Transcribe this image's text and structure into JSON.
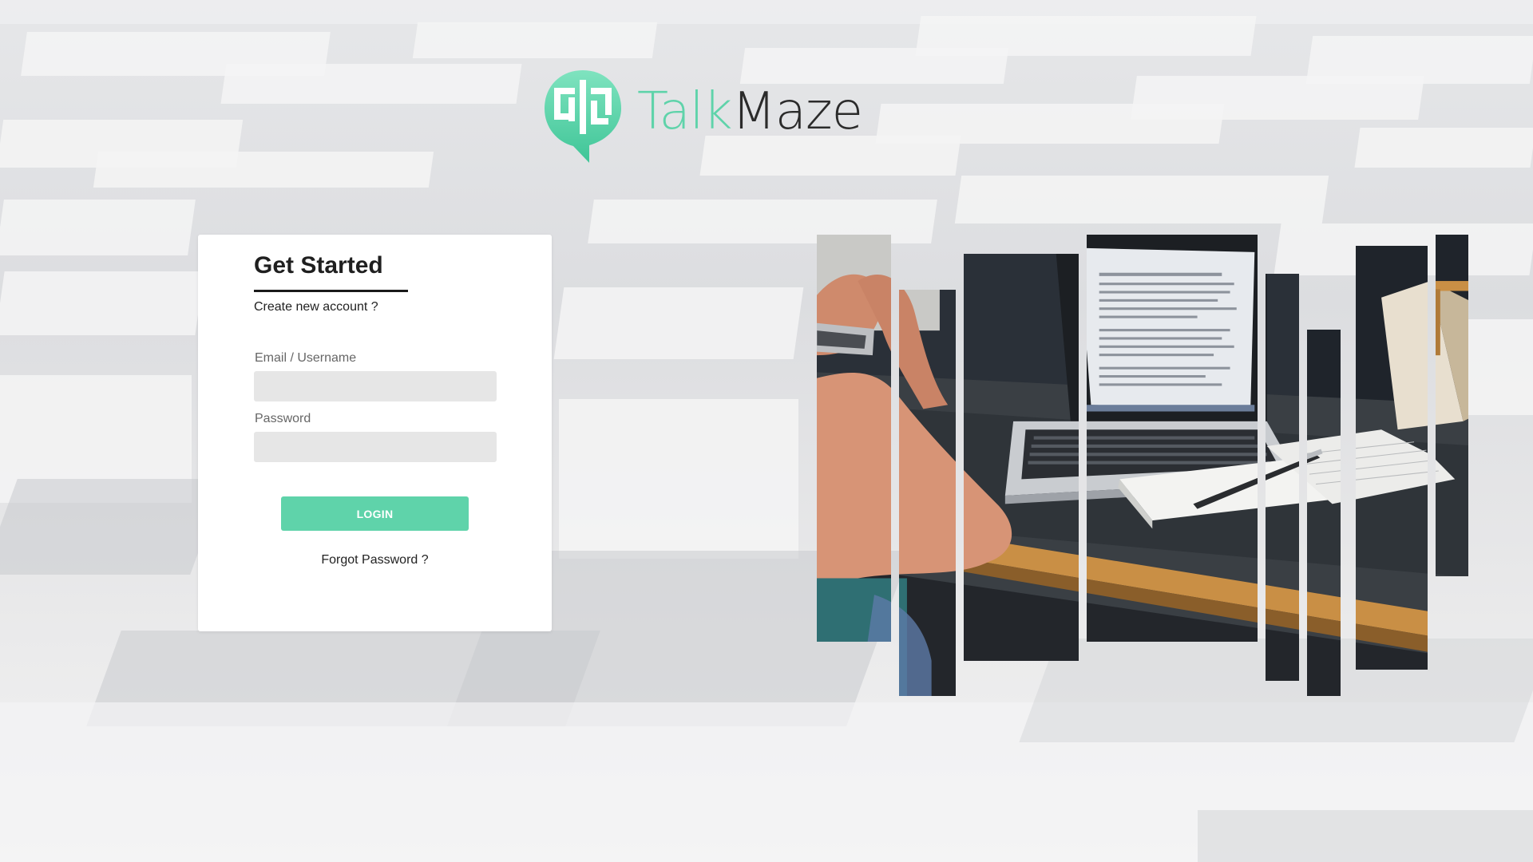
{
  "brand": {
    "name_part1": "Talk",
    "name_part2": "Maze",
    "accent_color": "#5fd3aa",
    "logo_icon": "maze-chat-bubble-icon"
  },
  "login": {
    "title": "Get Started",
    "create_account_link": "Create new account ?",
    "email_label": "Email / Username",
    "email_value": "",
    "password_label": "Password",
    "password_value": "",
    "login_button": "LOGIN",
    "forgot_password_link": "Forgot Password ?"
  },
  "colors": {
    "button": "#5fd3aa",
    "input_background": "#e6e6e6",
    "card_background": "#ffffff"
  },
  "hero_image": {
    "description_icon": "laptop-desk-photo-collage"
  }
}
